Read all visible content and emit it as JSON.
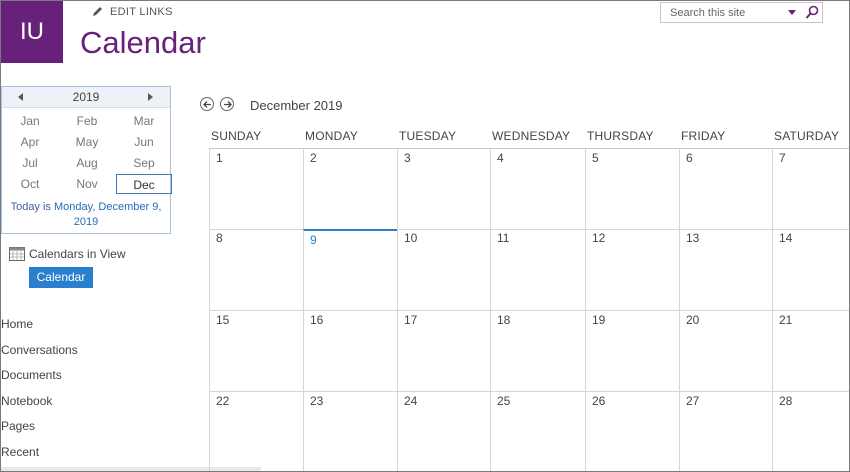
{
  "site": {
    "logo_text": "IU",
    "edit_links": "EDIT LINKS",
    "title": "Calendar"
  },
  "search": {
    "placeholder": "Search this site"
  },
  "picker": {
    "year": "2019",
    "months": [
      "Jan",
      "Feb",
      "Mar",
      "Apr",
      "May",
      "Jun",
      "Jul",
      "Aug",
      "Sep",
      "Oct",
      "Nov",
      "Dec"
    ],
    "selected_month": "Dec",
    "today_prefix": "Today is ",
    "today_link": "Monday, December 9, 2019"
  },
  "calendars_in_view": {
    "label": "Calendars in View",
    "chip": "Calendar"
  },
  "nav": [
    "Home",
    "Conversations",
    "Documents",
    "Notebook",
    "Pages",
    "Recent"
  ],
  "calendar": {
    "month_label": "December 2019",
    "days": [
      "SUNDAY",
      "MONDAY",
      "TUESDAY",
      "WEDNESDAY",
      "THURSDAY",
      "FRIDAY",
      "SATURDAY"
    ],
    "weeks": [
      [
        "1",
        "2",
        "3",
        "4",
        "5",
        "6",
        "7"
      ],
      [
        "8",
        "9",
        "10",
        "11",
        "12",
        "13",
        "14"
      ],
      [
        "15",
        "16",
        "17",
        "18",
        "19",
        "20",
        "21"
      ],
      [
        "22",
        "23",
        "24",
        "25",
        "26",
        "27",
        "28"
      ]
    ],
    "today": "9"
  },
  "colors": {
    "brand": "#68217a",
    "accent": "#2a7fcf"
  },
  "icons": {
    "edit": "pencil-icon",
    "search": "magnifier-icon",
    "prev": "arrow-left-circle-icon",
    "next": "arrow-right-circle-icon",
    "calendar": "calendar-icon"
  }
}
